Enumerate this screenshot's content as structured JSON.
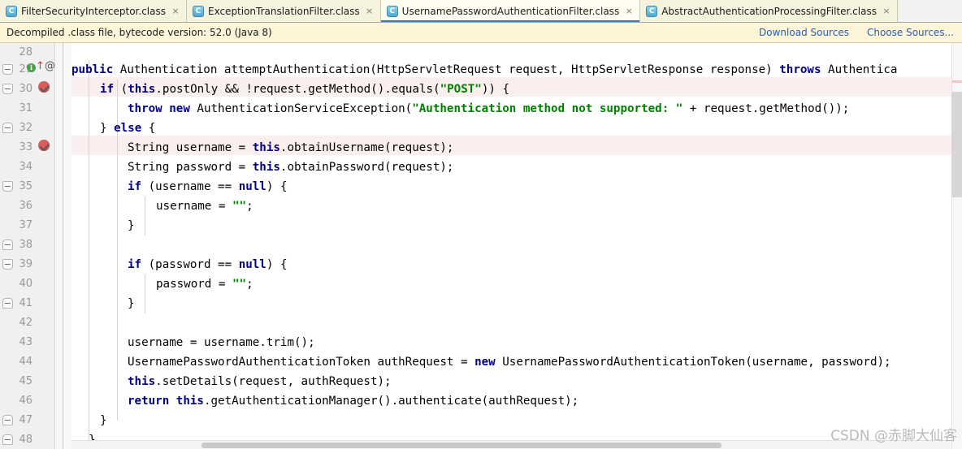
{
  "tabs": [
    {
      "label": "FilterSecurityInterceptor.class",
      "icon": "class-file-icon",
      "active": false,
      "close": "×"
    },
    {
      "label": "ExceptionTranslationFilter.class",
      "icon": "class-file-icon",
      "active": false,
      "close": "×"
    },
    {
      "label": "UsernamePasswordAuthenticationFilter.class",
      "icon": "class-file-icon",
      "active": true,
      "close": "×"
    },
    {
      "label": "AbstractAuthenticationProcessingFilter.class",
      "icon": "class-file-icon",
      "active": false,
      "close": "×"
    }
  ],
  "notification": {
    "message": "Decompiled .class file, bytecode version: 52.0 (Java 8)",
    "download_sources": "Download Sources",
    "choose_sources": "Choose Sources...",
    "background": "#fcf5d8",
    "link_color": "#2a5db0"
  },
  "editor": {
    "caret_line": 30,
    "tab_icon_letter": "C",
    "line_numbers": [
      28,
      29,
      30,
      31,
      32,
      33,
      34,
      35,
      36,
      37,
      38,
      39,
      40,
      41,
      42,
      43,
      44,
      45,
      46,
      47,
      48
    ],
    "lines": [
      {
        "num": 28,
        "text": "",
        "highlight": "none"
      },
      {
        "num": 29,
        "text": "    public Authentication attemptAuthentication(HttpServletRequest request, HttpServletResponse response) throws Authentica",
        "highlight": "none"
      },
      {
        "num": 30,
        "text": "        if (this.postOnly && !request.getMethod().equals(\"POST\")) {",
        "highlight": "error"
      },
      {
        "num": 31,
        "text": "            throw new AuthenticationServiceException(\"Authentication method not supported: \" + request.getMethod());",
        "highlight": "none"
      },
      {
        "num": 32,
        "text": "        } else {",
        "highlight": "none"
      },
      {
        "num": 33,
        "text": "            String username = this.obtainUsername(request);",
        "highlight": "error"
      },
      {
        "num": 34,
        "text": "            String password = this.obtainPassword(request);",
        "highlight": "none"
      },
      {
        "num": 35,
        "text": "            if (username == null) {",
        "highlight": "none"
      },
      {
        "num": 36,
        "text": "                username = \"\";",
        "highlight": "none"
      },
      {
        "num": 37,
        "text": "            }",
        "highlight": "none"
      },
      {
        "num": 38,
        "text": "",
        "highlight": "none"
      },
      {
        "num": 39,
        "text": "            if (password == null) {",
        "highlight": "none"
      },
      {
        "num": 40,
        "text": "                password = \"\";",
        "highlight": "none"
      },
      {
        "num": 41,
        "text": "            }",
        "highlight": "none"
      },
      {
        "num": 42,
        "text": "",
        "highlight": "none"
      },
      {
        "num": 43,
        "text": "            username = username.trim();",
        "highlight": "none"
      },
      {
        "num": 44,
        "text": "            UsernamePasswordAuthenticationToken authRequest = new UsernamePasswordAuthenticationToken(username, password);",
        "highlight": "none"
      },
      {
        "num": 45,
        "text": "            this.setDetails(request, authRequest);",
        "highlight": "none"
      },
      {
        "num": 46,
        "text": "            return this.getAuthenticationManager().authenticate(authRequest);",
        "highlight": "none"
      },
      {
        "num": 47,
        "text": "        }",
        "highlight": "none"
      },
      {
        "num": 48,
        "text": "    }",
        "highlight": "none"
      }
    ],
    "gutter_icons": [
      {
        "line": 29,
        "icons": [
          "info-icon",
          "override-arrow-icon",
          "annotation-at-icon"
        ]
      },
      {
        "line": 30,
        "icons": [
          "breakpoint-verified-icon"
        ]
      },
      {
        "line": 33,
        "icons": [
          "breakpoint-verified-icon"
        ]
      }
    ],
    "fold_markers": [
      {
        "line": 29,
        "type": "collapse-top"
      },
      {
        "line": 30,
        "type": "collapse-top"
      },
      {
        "line": 32,
        "type": "collapse-bottom"
      },
      {
        "line": 35,
        "type": "collapse-top"
      },
      {
        "line": 37,
        "type": "collapse-bottom"
      },
      {
        "line": 39,
        "type": "collapse-top"
      },
      {
        "line": 41,
        "type": "collapse-bottom"
      },
      {
        "line": 47,
        "type": "collapse-bottom"
      },
      {
        "line": 48,
        "type": "collapse-bottom"
      }
    ],
    "colors": {
      "keyword": "#000080",
      "string": "#008000",
      "plain": "#000000",
      "error_line_bg": "#fbeeee",
      "caret_line_gutter_bg": "#fdf6d8",
      "gutter_bg": "#f0f0f0",
      "line_number": "#999999"
    }
  },
  "watermark": {
    "text": "CSDN @赤脚大仙客"
  }
}
